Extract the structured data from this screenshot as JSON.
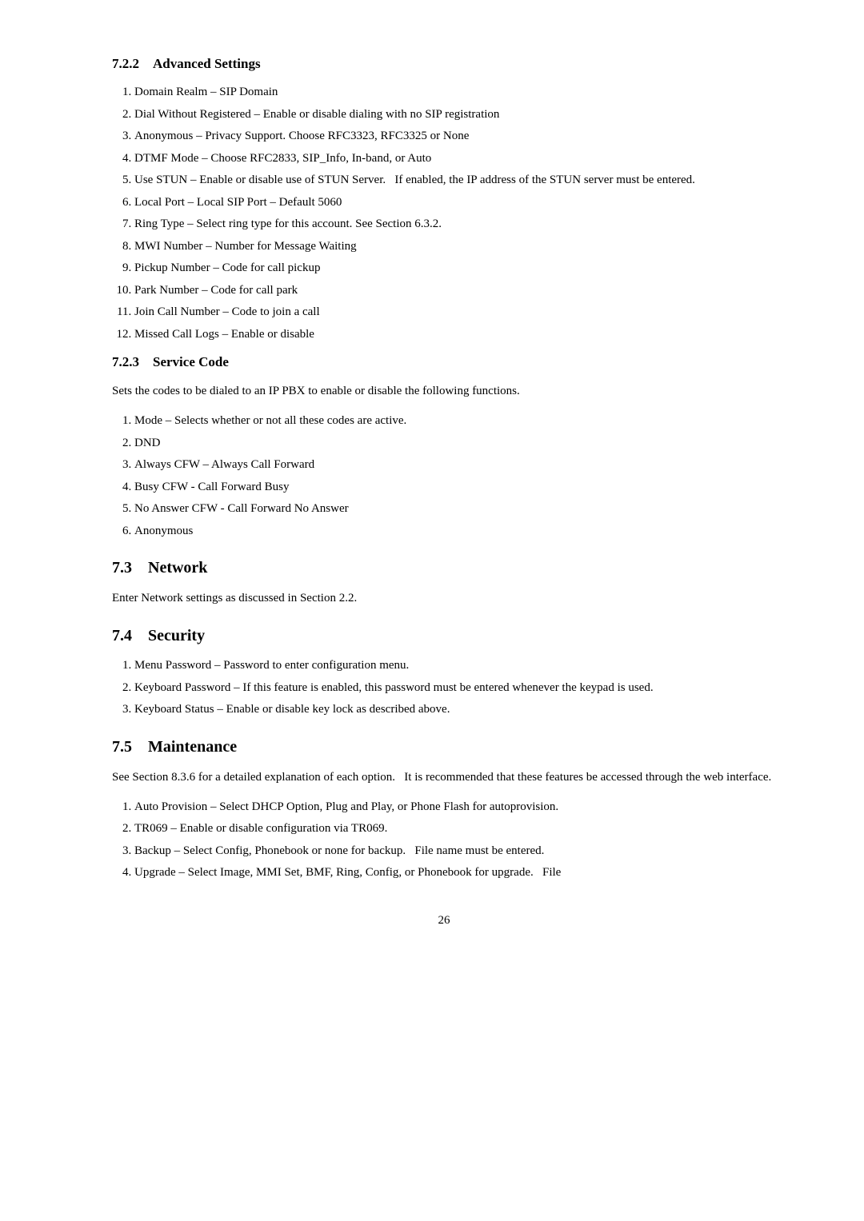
{
  "sections": {
    "s722": {
      "heading": "7.2.2    Advanced Settings",
      "items": [
        "Domain Realm – SIP Domain",
        "Dial Without Registered – Enable or disable dialing with no SIP registration",
        "Anonymous – Privacy Support. Choose RFC3323, RFC3325 or None",
        "DTMF Mode – Choose RFC2833, SIP_Info, In-band, or Auto",
        "Use STUN – Enable or disable use of STUN Server.   If enabled, the IP address of the STUN server must be entered.",
        "Local Port – Local SIP Port – Default 5060",
        "Ring Type – Select ring type for this account. See Section 6.3.2.",
        "MWI Number – Number for Message Waiting",
        "Pickup Number – Code for call pickup",
        "Park Number – Code for call park",
        "Join Call Number – Code to join a call",
        "Missed Call Logs – Enable or disable"
      ]
    },
    "s723": {
      "heading": "7.2.3    Service Code",
      "intro": "Sets the codes to be dialed to an IP PBX to enable or disable the following functions.",
      "items": [
        "Mode – Selects whether or not all these codes are active.",
        "DND",
        "Always CFW – Always Call Forward",
        "Busy CFW - Call Forward Busy",
        "No Answer CFW - Call Forward No Answer",
        "Anonymous"
      ]
    },
    "s73": {
      "heading": "7.3    Network",
      "intro": "Enter Network settings as discussed in Section 2.2."
    },
    "s74": {
      "heading": "7.4    Security",
      "items": [
        "Menu Password – Password to enter configuration menu.",
        "Keyboard Password – If this feature is enabled, this password must be entered whenever the keypad is used.",
        "Keyboard Status – Enable or disable key lock as described above."
      ]
    },
    "s75": {
      "heading": "7.5    Maintenance",
      "intro": "See Section 8.3.6 for a detailed explanation of each option.   It is recommended that these features be accessed through the web interface.",
      "items": [
        "Auto Provision – Select DHCP Option, Plug and Play, or Phone Flash for autoprovision.",
        "TR069 – Enable or disable configuration via TR069.",
        "Backup – Select Config, Phonebook or none for backup.   File name must be entered.",
        "Upgrade – Select Image, MMI Set, BMF, Ring, Config, or Phonebook for upgrade.   File"
      ]
    }
  },
  "page_number": "26"
}
